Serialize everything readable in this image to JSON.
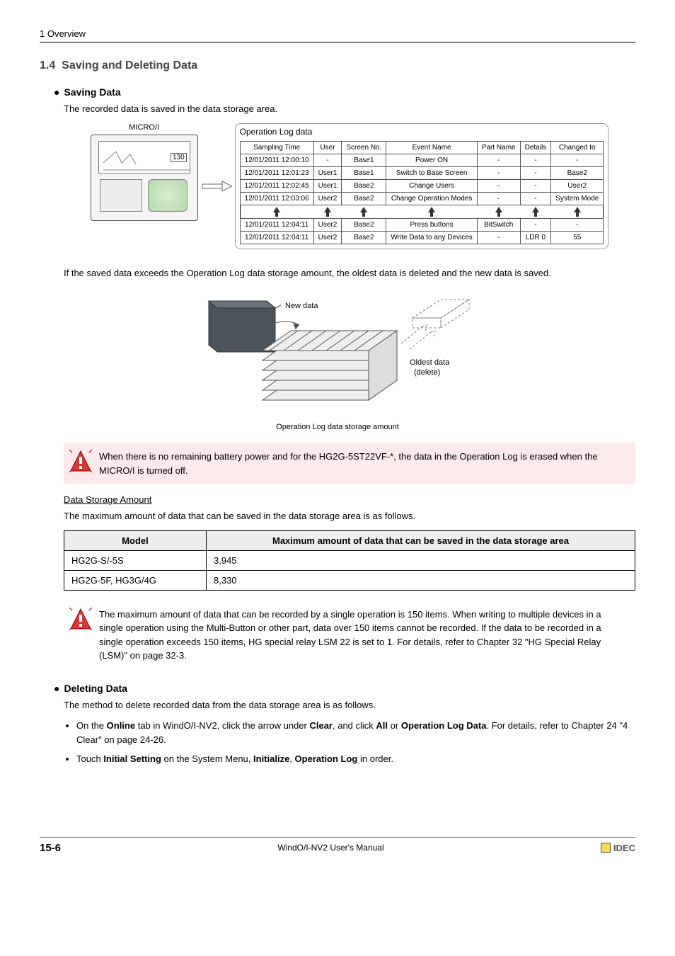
{
  "header": {
    "chapter": "1 Overview"
  },
  "section": {
    "num": "1.4",
    "title": "Saving and Deleting Data"
  },
  "saving": {
    "heading": "Saving Data",
    "intro": "The recorded data is saved in the data storage area.",
    "micro_label": "MICRO/I",
    "box130": "130",
    "oplog_title": "Operation Log data",
    "columns": [
      "Sampling Time",
      "User",
      "Screen No.",
      "Event Name",
      "Part Name",
      "Details",
      "Changed to"
    ],
    "rows_a": [
      [
        "12/01/2011 12:00:10",
        "-",
        "Base1",
        "Power ON",
        "-",
        "-",
        "-"
      ],
      [
        "12/01/2011 12:01:23",
        "User1",
        "Base1",
        "Switch to Base Screen",
        "-",
        "-",
        "Base2"
      ],
      [
        "12/01/2011 12:02:45",
        "User1",
        "Base2",
        "Change Users",
        "-",
        "-",
        "User2"
      ],
      [
        "12/01/2011 12:03:06",
        "User2",
        "Base2",
        "Change Operation Modes",
        "-",
        "-",
        "System Mode"
      ]
    ],
    "rows_b": [
      [
        "12/01/2011 12:04:11",
        "User2",
        "Base2",
        "Press buttons",
        "BitSwitch",
        "-",
        "-"
      ],
      [
        "12/01/2011 12:04:11",
        "User2",
        "Base2",
        "Write Data to any Devices",
        "-",
        "LDR 0",
        "55"
      ]
    ],
    "exceed_text": "If the saved data exceeds the Operation Log data storage amount, the oldest data is deleted and the new data is saved.",
    "fig2_new": "New data",
    "fig2_old1": "Oldest data",
    "fig2_old2": "(delete)",
    "fig2_caption": "Operation Log data storage amount",
    "warn1": "When there is no remaining battery power and for the HG2G-5ST22VF-*, the data in the Operation Log is erased when the MICRO/I is turned off.",
    "storage_heading": "Data Storage Amount",
    "storage_intro": "The maximum amount of data that can be saved in the data storage area is as follows.",
    "storage_cols": [
      "Model",
      "Maximum amount of data that can be saved in the data storage area"
    ],
    "storage_rows": [
      [
        "HG2G-S/-5S",
        "3,945"
      ],
      [
        "HG2G-5F, HG3G/4G",
        "8,330"
      ]
    ],
    "warn2": "The maximum amount of data that can be recorded by a single operation is 150 items. When writing to multiple devices in a single operation using the Multi-Button or other part, data over 150 items cannot be recorded. If the data to be recorded in a single operation exceeds 150 items, HG special relay LSM 22 is set to 1. For details, refer to Chapter 32 \"HG Special Relay (LSM)\" on page 32-3."
  },
  "deleting": {
    "heading": "Deleting Data",
    "intro": "The method to delete recorded data from the data storage area is as follows.",
    "b1a": "On the ",
    "b1b": "Online",
    "b1c": " tab in WindO/I-NV2, click the arrow under ",
    "b1d": "Clear",
    "b1e": ", and click ",
    "b1f": "All",
    "b1g": " or ",
    "b1h": "Operation Log Data",
    "b1i": ". For details, refer to Chapter 24 \"4 Clear\" on page 24-26.",
    "b2a": "Touch ",
    "b2b": "Initial Setting",
    "b2c": " on the System Menu, ",
    "b2d": "Initialize",
    "b2e": ", ",
    "b2f": "Operation Log",
    "b2g": " in order."
  },
  "footer": {
    "pagenum": "15-6",
    "manual": "WindO/I-NV2 User's Manual",
    "brand": "IDEC"
  }
}
